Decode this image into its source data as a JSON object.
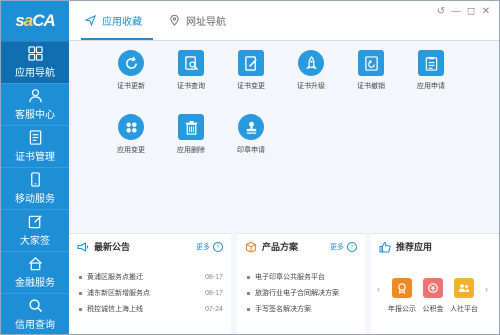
{
  "colors": {
    "accent": "#1e8fd6",
    "sidebar": "#1e8fd6",
    "sidebar_active": "#0f6db0",
    "orange": "#f08a24",
    "pink": "#ef7373",
    "yellow": "#f2b12c"
  },
  "logo": {
    "text_1": "s",
    "text_2": "a",
    "text_3": "CA"
  },
  "sidebar": {
    "items": [
      {
        "label": "应用导航",
        "icon": "grid-icon"
      },
      {
        "label": "客服中心",
        "icon": "user-icon"
      },
      {
        "label": "证书管理",
        "icon": "document-icon"
      },
      {
        "label": "移动服务",
        "icon": "phone-icon"
      },
      {
        "label": "大家签",
        "icon": "edit-icon"
      },
      {
        "label": "金融服务",
        "icon": "home-icon"
      },
      {
        "label": "信用查询",
        "icon": "search-icon"
      }
    ]
  },
  "tabs": [
    {
      "label": "应用收藏",
      "icon": "send-icon"
    },
    {
      "label": "网址导航",
      "icon": "location-icon"
    }
  ],
  "window_controls": [
    "↺",
    "—",
    "◻",
    "✕"
  ],
  "apps": [
    {
      "label": "证书更新",
      "icon": "refresh-icon"
    },
    {
      "label": "证书查询",
      "icon": "search-icon"
    },
    {
      "label": "证书变更",
      "icon": "document-edit-icon"
    },
    {
      "label": "证书升级",
      "icon": "rocket-icon"
    },
    {
      "label": "证书撤销",
      "icon": "undo-icon"
    },
    {
      "label": "应用申请",
      "icon": "clipboard-icon"
    },
    {
      "label": "应用变更",
      "icon": "cycle-icon"
    },
    {
      "label": "应用删除",
      "icon": "trash-icon"
    },
    {
      "label": "印章申请",
      "icon": "seal-icon"
    }
  ],
  "news": {
    "title": "最新公告",
    "more": "更多",
    "items": [
      {
        "text": "黄浦区服务点搬迁",
        "date": "08-17"
      },
      {
        "text": "浦东新区新增服务点",
        "date": "08-17"
      },
      {
        "text": "税控诚信上海上线",
        "date": "07-24"
      }
    ]
  },
  "products": {
    "title": "产品方案",
    "more": "更多",
    "items": [
      {
        "text": "电子印章公共服务平台"
      },
      {
        "text": "旅游行业电子合同解决方案"
      },
      {
        "text": "手写签名解决方案"
      }
    ]
  },
  "recommend": {
    "title": "推荐应用",
    "items": [
      {
        "label": "年报公示",
        "icon": "badge-icon",
        "color": "#f08a24"
      },
      {
        "label": "公积金",
        "icon": "coin-icon",
        "color": "#ef7373"
      },
      {
        "label": "人社平台",
        "icon": "people-icon",
        "color": "#f2b12c"
      }
    ]
  }
}
